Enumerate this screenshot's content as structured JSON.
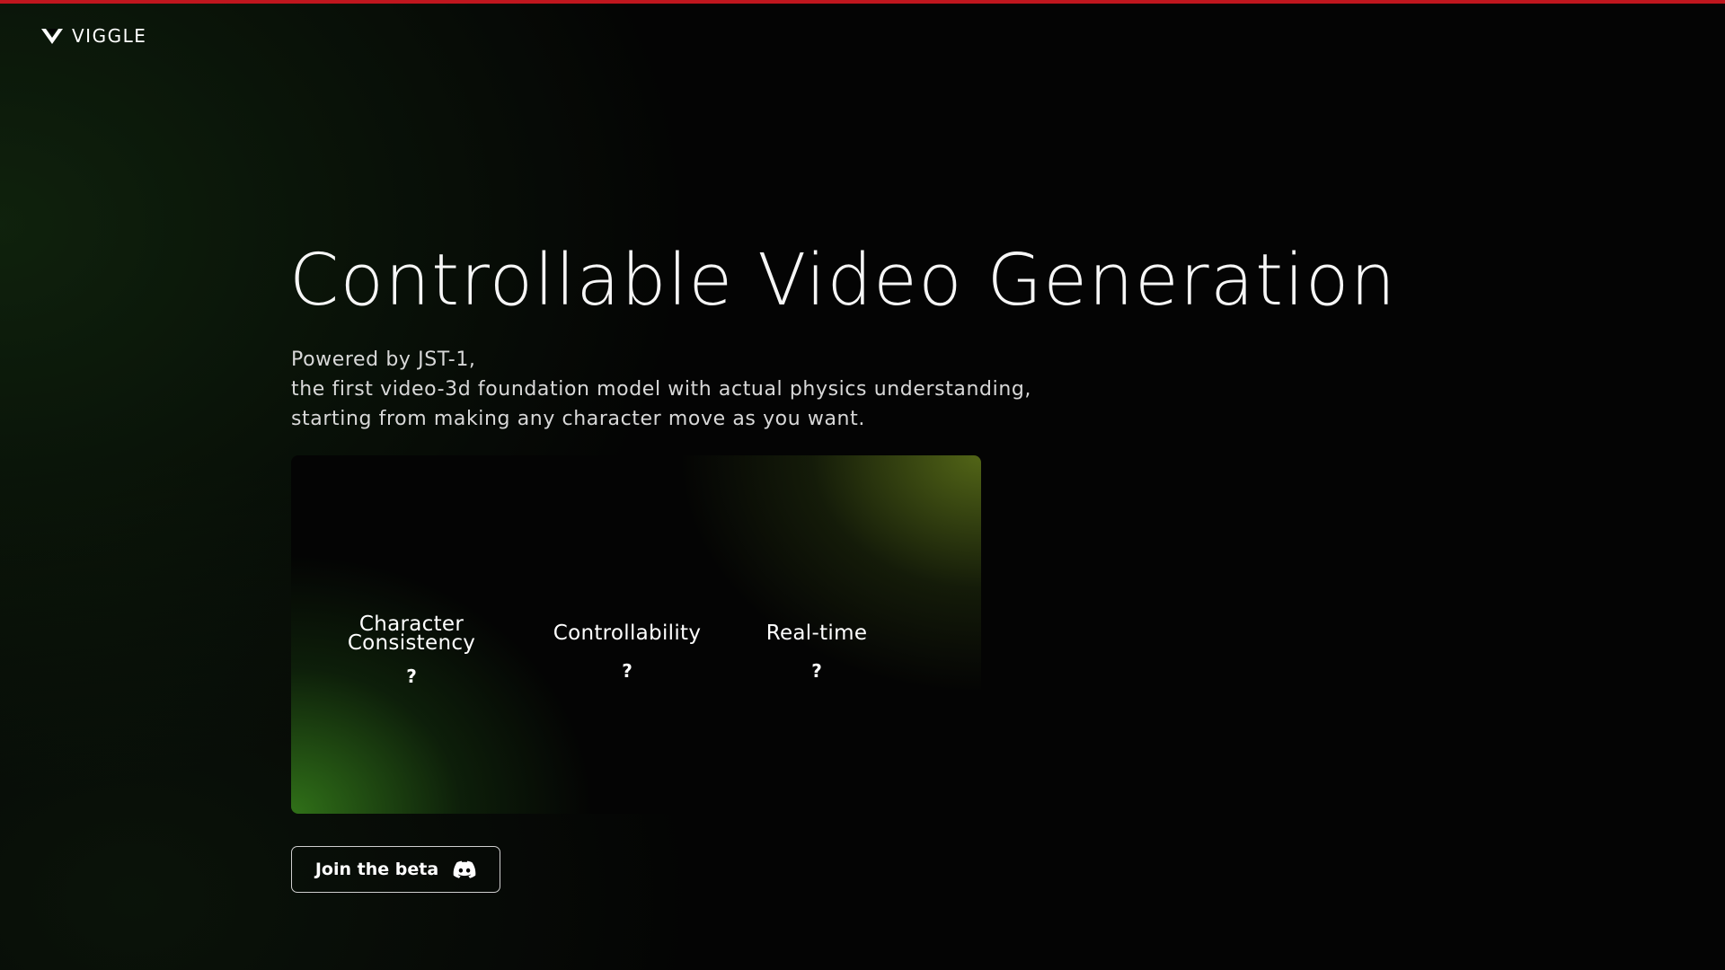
{
  "header": {
    "logo_text": "VIGGLE",
    "logo_icon": "viggle-v-logo-icon"
  },
  "hero": {
    "title": "Controllable Video Generation",
    "subtitle_lines": [
      "Powered by JST-1,",
      "the first video-3d foundation model with actual physics understanding,",
      "starting from making any character move as you want."
    ]
  },
  "features": [
    {
      "label_lines": [
        "Character",
        "Consistency"
      ],
      "mark": "?"
    },
    {
      "label_lines": [
        "Controllability"
      ],
      "mark": "?"
    },
    {
      "label_lines": [
        "Real-time"
      ],
      "mark": "?"
    }
  ],
  "cta": {
    "label": "Join the beta",
    "icon": "discord-icon"
  },
  "colors": {
    "top_bar": "#c0161e",
    "background": "#040404",
    "card_green": "#38841c",
    "card_olive": "#60761a"
  }
}
